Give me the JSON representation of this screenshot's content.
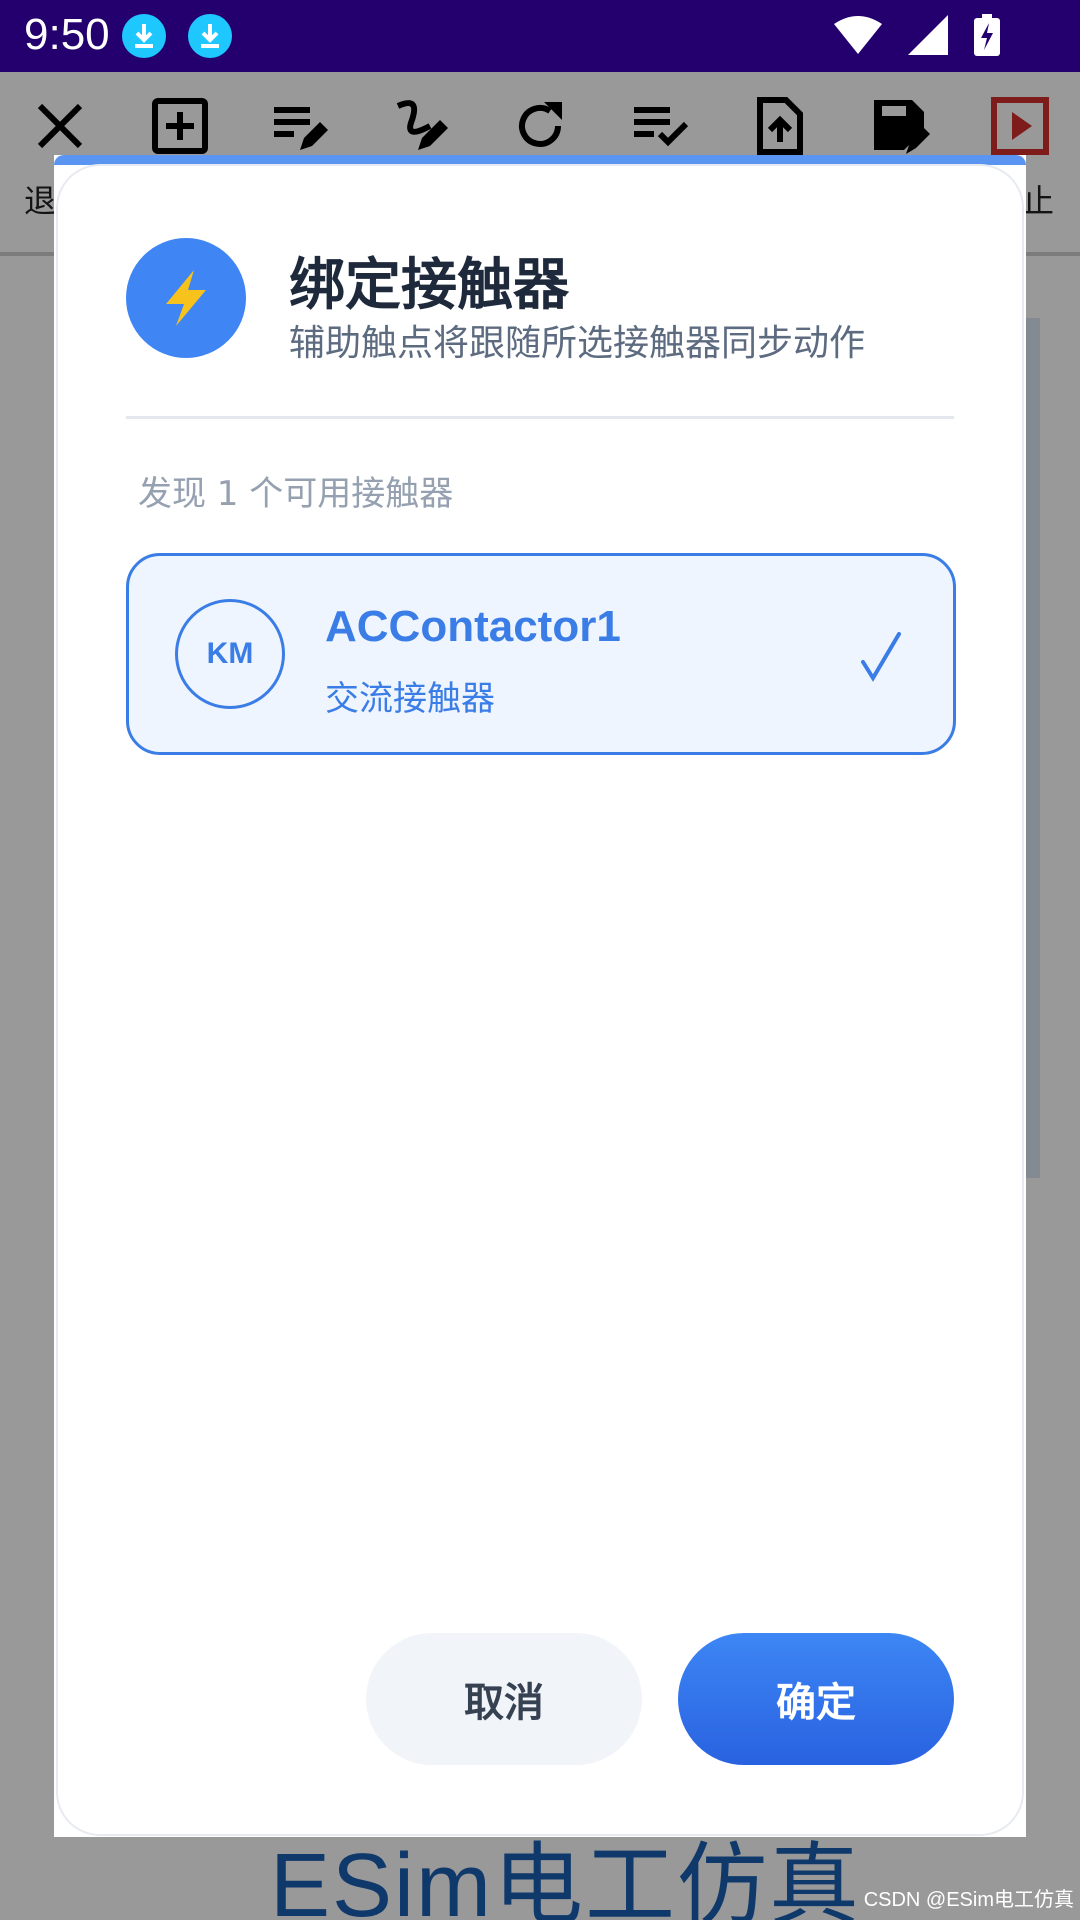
{
  "status_bar": {
    "time": "9:50"
  },
  "toolbar": {
    "label_left": "退",
    "label_right": "止"
  },
  "background": {
    "logo_text": "ESim电工仿真"
  },
  "dialog": {
    "title": "绑定接触器",
    "subtitle": "辅助触点将跟随所选接触器同步动作",
    "found_label": "发现 1 个可用接触器",
    "items": [
      {
        "badge": "KM",
        "name": "ACContactor1",
        "type": "交流接触器",
        "selected": true
      }
    ],
    "cancel_label": "取消",
    "confirm_label": "确定"
  },
  "watermark": "CSDN @ESim电工仿真",
  "colors": {
    "accent": "#3b7de6",
    "status_bar": "#23006e",
    "primary_button": "#2f6fe8",
    "bolt": "#f7c21b",
    "stop_icon": "#d32f2f"
  }
}
